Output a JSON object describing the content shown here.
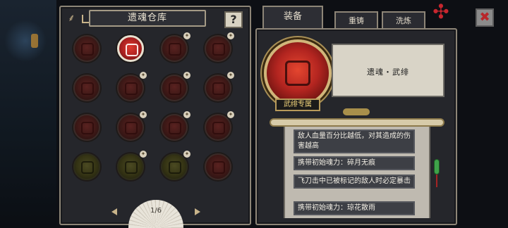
{
  "warehouse": {
    "title": "遗魂仓库",
    "help_label": "?",
    "page_indicator": "1/6",
    "slots": [
      {
        "state": "dim",
        "equipped": false
      },
      {
        "state": "active",
        "equipped": false
      },
      {
        "state": "dim",
        "equipped": true
      },
      {
        "state": "dim",
        "equipped": true
      },
      {
        "state": "dim",
        "equipped": false
      },
      {
        "state": "dim",
        "equipped": true
      },
      {
        "state": "dim",
        "equipped": true
      },
      {
        "state": "dim",
        "equipped": true
      },
      {
        "state": "dim",
        "equipped": false
      },
      {
        "state": "dim",
        "equipped": true
      },
      {
        "state": "dim",
        "equipped": true
      },
      {
        "state": "dim",
        "equipped": true
      },
      {
        "state": "locked",
        "equipped": false
      },
      {
        "state": "locked",
        "equipped": true
      },
      {
        "state": "locked",
        "equipped": true
      },
      {
        "state": "dim",
        "equipped": false
      }
    ]
  },
  "tabs": {
    "equip": "装备",
    "forge": "重铸",
    "wash": "洗炼"
  },
  "close_label": "✖",
  "detail": {
    "name": "遗魂・武绯",
    "exclusive_label": "武绯专属",
    "effects": [
      "敌人血量百分比越低，对其造成的伤害越高",
      "携带初始魂力：碎月无痕",
      "飞刀击中已被标记的敌人时必定暴击",
      "携带初始魂力：琼花散雨"
    ]
  },
  "colors": {
    "accent_red": "#c7262e",
    "frame": "#8d8577",
    "gold": "#f0d37a"
  }
}
